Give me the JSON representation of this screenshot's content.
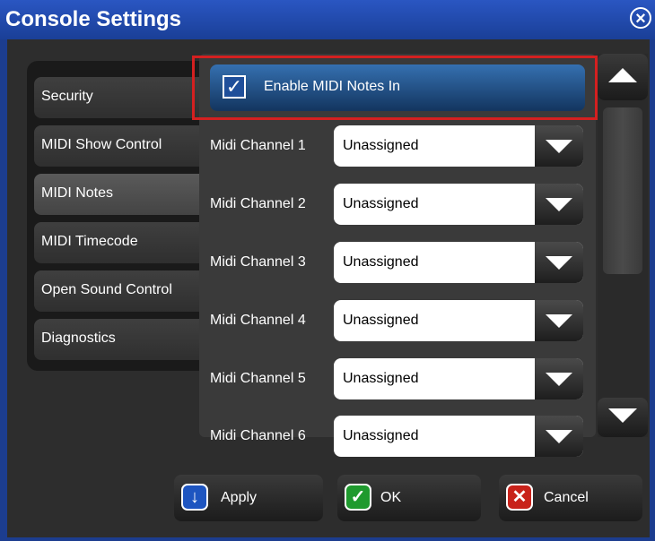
{
  "window": {
    "title": "Console Settings",
    "close_icon": "close-icon"
  },
  "tabs": [
    {
      "label": "Security",
      "active": false
    },
    {
      "label": "MIDI Show Control",
      "active": false
    },
    {
      "label": "MIDI Notes",
      "active": true
    },
    {
      "label": "MIDI Timecode",
      "active": false
    },
    {
      "label": "Open Sound Control",
      "active": false
    },
    {
      "label": "Diagnostics",
      "active": false
    }
  ],
  "enable": {
    "label": "Enable MIDI Notes In",
    "checked": true,
    "check_glyph": "✓"
  },
  "channels": [
    {
      "label": "Midi Channel 1",
      "value": "Unassigned"
    },
    {
      "label": "Midi Channel 2",
      "value": "Unassigned"
    },
    {
      "label": "Midi Channel 3",
      "value": "Unassigned"
    },
    {
      "label": "Midi Channel 4",
      "value": "Unassigned"
    },
    {
      "label": "Midi Channel 5",
      "value": "Unassigned"
    },
    {
      "label": "Midi Channel 6",
      "value": "Unassigned"
    }
  ],
  "buttons": {
    "apply": {
      "label": "Apply",
      "glyph": "↓"
    },
    "ok": {
      "label": "OK",
      "glyph": "✓"
    },
    "cancel": {
      "label": "Cancel",
      "glyph": "✕"
    }
  },
  "colors": {
    "title_bar": "#1a3f97",
    "highlight_border": "#d42020",
    "apply": "#1e55c0",
    "ok": "#1f9a2e",
    "cancel": "#c8221a"
  }
}
